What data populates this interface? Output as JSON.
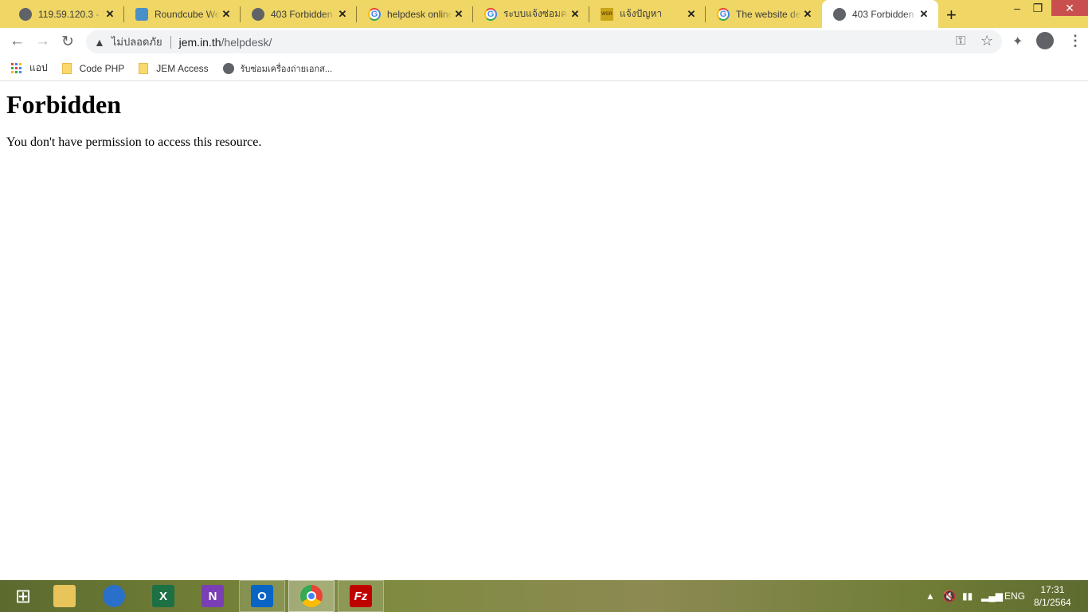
{
  "tabs": [
    {
      "title": "119.59.120.3 - I",
      "icon": "globe-icon"
    },
    {
      "title": "Roundcube We",
      "icon": "roundcube-icon"
    },
    {
      "title": "403 Forbidden",
      "icon": "globe-icon"
    },
    {
      "title": "helpdesk online",
      "icon": "google-icon"
    },
    {
      "title": "ระบบแจ้งซ่อมคอม",
      "icon": "google-icon"
    },
    {
      "title": "แจ้งปัญหา",
      "icon": "wsr-icon",
      "favicon_text": "WSR"
    },
    {
      "title": "The website de",
      "icon": "google-icon"
    },
    {
      "title": "403 Forbidden",
      "icon": "globe-icon",
      "active": true
    }
  ],
  "omnibox": {
    "security": "ไม่ปลอดภัย",
    "host": "jem.in.th",
    "path": "/helpdesk/"
  },
  "bookmarks": [
    {
      "label": "แอป"
    },
    {
      "label": "Code PHP"
    },
    {
      "label": "JEM Access"
    },
    {
      "label": "รับซ่อมเครื่องถ่ายเอกส..."
    }
  ],
  "page": {
    "heading": "Forbidden",
    "message": "You don't have permission to access this resource."
  },
  "taskbar": {
    "apps": [
      "start",
      "file-explorer",
      "thunderbird",
      "excel",
      "onenote",
      "outlook",
      "chrome",
      "filezilla"
    ],
    "lang": "ENG",
    "time": "17:31",
    "date": "8/1/2564"
  },
  "colors": {
    "tabstrip": "#efd665",
    "close": "#c94f4f"
  }
}
